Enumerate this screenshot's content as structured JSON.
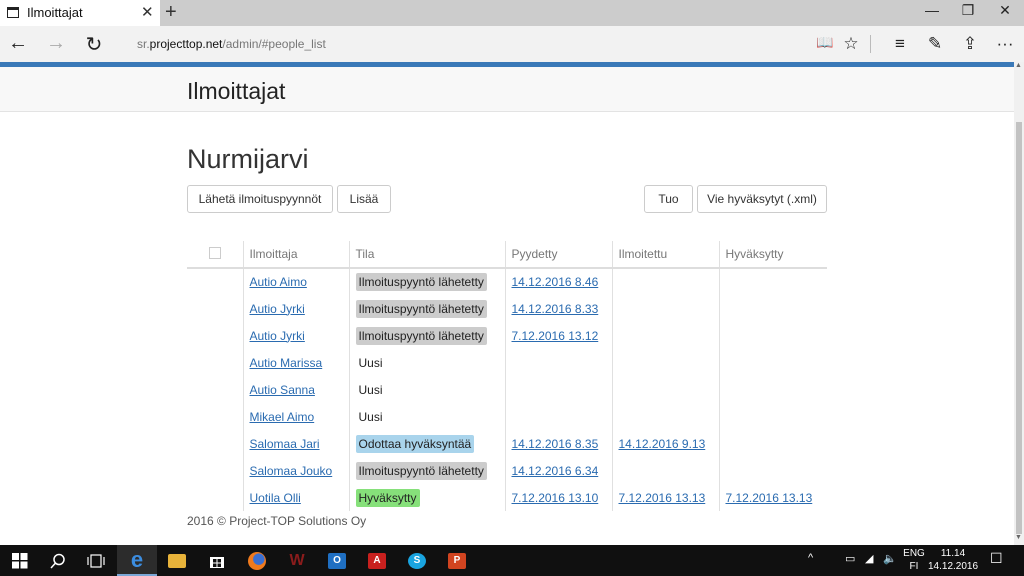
{
  "browser": {
    "tab_title": "Ilmoittajat",
    "tab_close": "✕",
    "new_tab": "+",
    "address_prefix": "sr.",
    "address_domain": "projecttop.net",
    "address_path": "/admin/#people_list",
    "minimize": "—",
    "restore": "❐",
    "close": "✕",
    "back": "←",
    "forward": "→",
    "refresh": "↻",
    "reading_view": "📖",
    "favorite": "☆",
    "hub": "≡",
    "note": "✎",
    "share": "⇪",
    "more": "···"
  },
  "page": {
    "header_title": "Ilmoittajat",
    "org_title": "Nurmijarvi",
    "buttons": {
      "send_requests": "Lähetä ilmoituspyynnöt",
      "add": "Lisää",
      "import": "Tuo",
      "export": "Vie hyväksytyt (.xml)"
    },
    "table": {
      "headers": [
        "Ilmoittaja",
        "Tila",
        "Pyydetty",
        "Ilmoitettu",
        "Hyväksytty"
      ],
      "rows": [
        {
          "name": "Autio Aimo",
          "status": "Ilmoituspyyntö lähetetty",
          "status_type": "gray",
          "requested": "14.12.2016 8.46",
          "reported": "",
          "approved": ""
        },
        {
          "name": "Autio Jyrki",
          "status": "Ilmoituspyyntö lähetetty",
          "status_type": "gray",
          "requested": "14.12.2016 8.33",
          "reported": "",
          "approved": ""
        },
        {
          "name": "Autio Jyrki",
          "status": "Ilmoituspyyntö lähetetty",
          "status_type": "gray",
          "requested": "7.12.2016 13.12",
          "reported": "",
          "approved": ""
        },
        {
          "name": "Autio Marissa",
          "status": "Uusi",
          "status_type": "plain",
          "requested": "",
          "reported": "",
          "approved": ""
        },
        {
          "name": "Autio Sanna",
          "status": "Uusi",
          "status_type": "plain",
          "requested": "",
          "reported": "",
          "approved": ""
        },
        {
          "name": "Mikael Aimo",
          "status": "Uusi",
          "status_type": "plain",
          "requested": "",
          "reported": "",
          "approved": ""
        },
        {
          "name": "Salomaa Jari",
          "status": "Odottaa hyväksyntää",
          "status_type": "blue",
          "requested": "14.12.2016 8.35",
          "reported": "14.12.2016 9.13",
          "approved": ""
        },
        {
          "name": "Salomaa Jouko",
          "status": "Ilmoituspyyntö lähetetty",
          "status_type": "gray",
          "requested": "14.12.2016 6.34",
          "reported": "",
          "approved": ""
        },
        {
          "name": "Uotila Olli",
          "status": "Hyväksytty",
          "status_type": "green",
          "requested": "7.12.2016 13.10",
          "reported": "7.12.2016 13.13",
          "approved": "7.12.2016 13.13"
        }
      ]
    },
    "footer": "2016 © Project-TOP Solutions Oy"
  },
  "colors": {
    "accent": "#3a79b8",
    "link": "#2a6bb0",
    "status_gray": "#cccccc",
    "status_blue": "#a9d4ec",
    "status_green": "#86e07a"
  },
  "taskbar": {
    "apps": [
      "start-icon",
      "search-icon",
      "task-view-icon",
      "edge-icon",
      "file-explorer-icon",
      "store-icon",
      "firefox-icon",
      "word-icon",
      "outlook-icon",
      "acrobat-icon",
      "skype-icon",
      "powerpoint-icon"
    ],
    "lang_1": "ENG",
    "lang_2": "FI",
    "time": "11.14",
    "date": "14.12.2016"
  }
}
